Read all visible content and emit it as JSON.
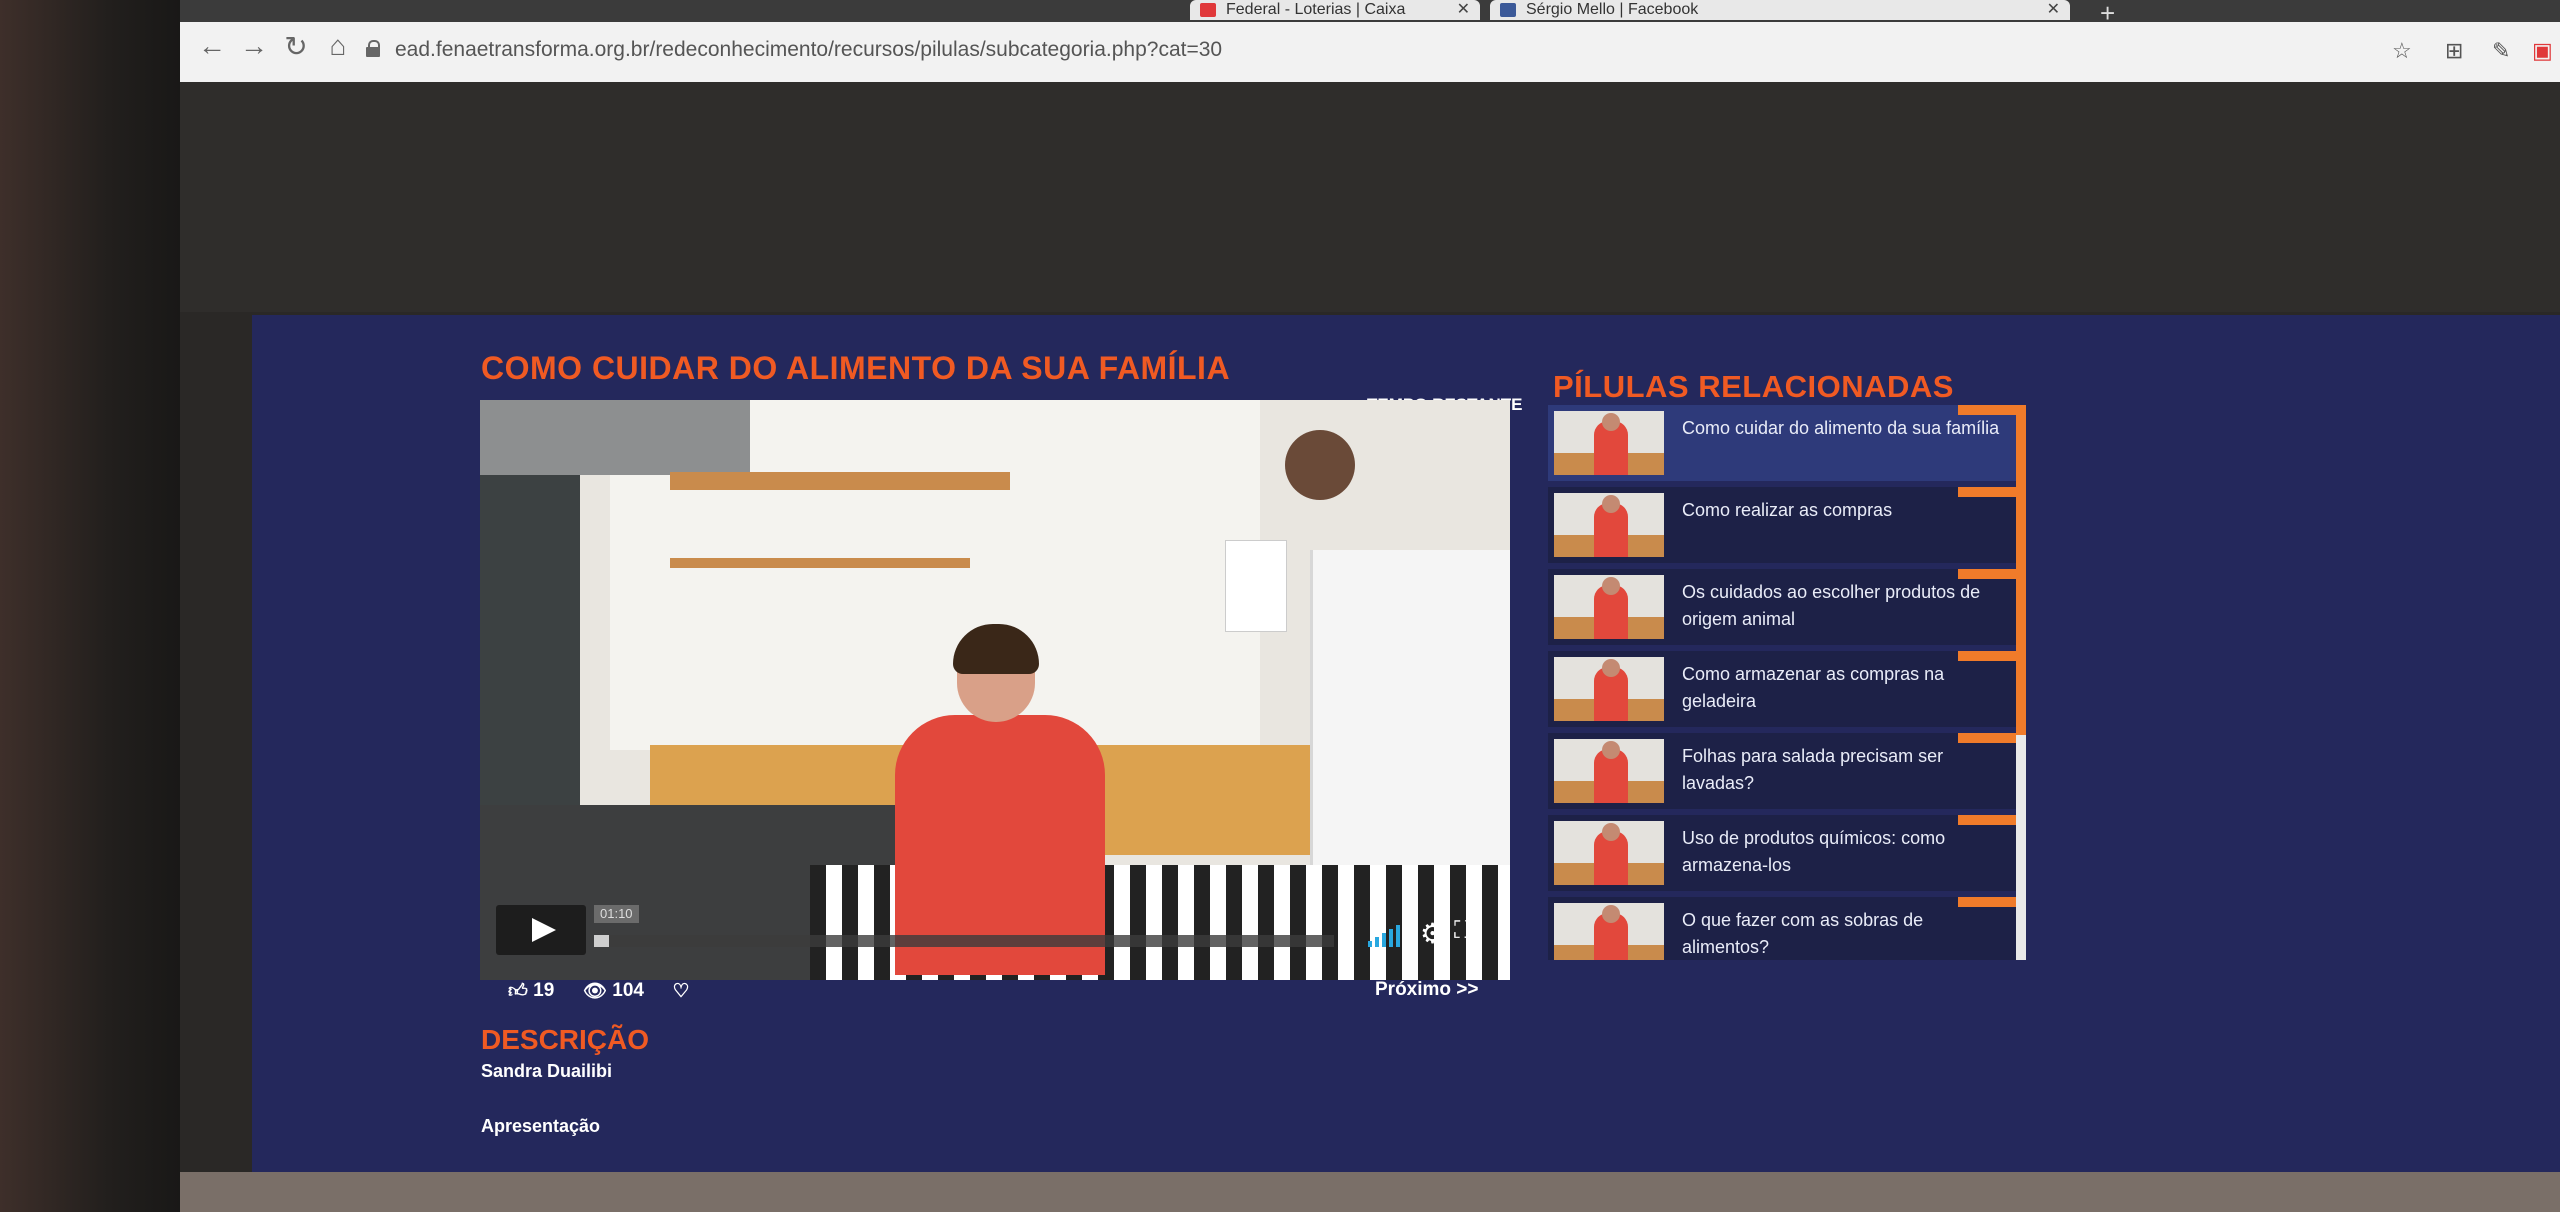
{
  "browser": {
    "tabs": [
      {
        "label": "Federal - Loterias | Caixa",
        "favicon_color": "#e0383a"
      },
      {
        "label": "Sérgio Mello | Facebook",
        "favicon_color": "#3b5998"
      }
    ],
    "url": "ead.fenaetransforma.org.br/redeconhecimento/recursos/pilulas/subcategoria.php?cat=30",
    "accent": "#e0383a"
  },
  "main": {
    "title": "COMO CUIDAR DO ALIMENTO DA SUA FAMÍLIA",
    "tempo_label": "TEMPO RESTANTE",
    "player": {
      "current_time": "01:10",
      "progress": 0.02
    },
    "stats": {
      "likes": "19",
      "views": "104"
    },
    "next_label": "Próximo >>",
    "description_heading": "DESCRIÇÃO",
    "author": "Sandra Duailibi",
    "presentation": "Apresentação"
  },
  "related": {
    "heading": "PÍLULAS RELACIONADAS",
    "items": [
      {
        "title": "Como cuidar do alimento da sua família",
        "active": true
      },
      {
        "title": "Como realizar as compras",
        "active": false
      },
      {
        "title": "Os cuidados ao escolher produtos de origem animal",
        "active": false
      },
      {
        "title": "Como armazenar as compras na geladeira",
        "active": false
      },
      {
        "title": "Folhas para salada precisam ser lavadas?",
        "active": false
      },
      {
        "title": "Uso de produtos químicos: como armazena-los",
        "active": false
      },
      {
        "title": "O que fazer com as sobras de alimentos?",
        "active": false
      }
    ]
  },
  "colors": {
    "accent_orange": "#f05a23",
    "page_bg": "#24285c",
    "volume_blue": "#29a8e0"
  }
}
